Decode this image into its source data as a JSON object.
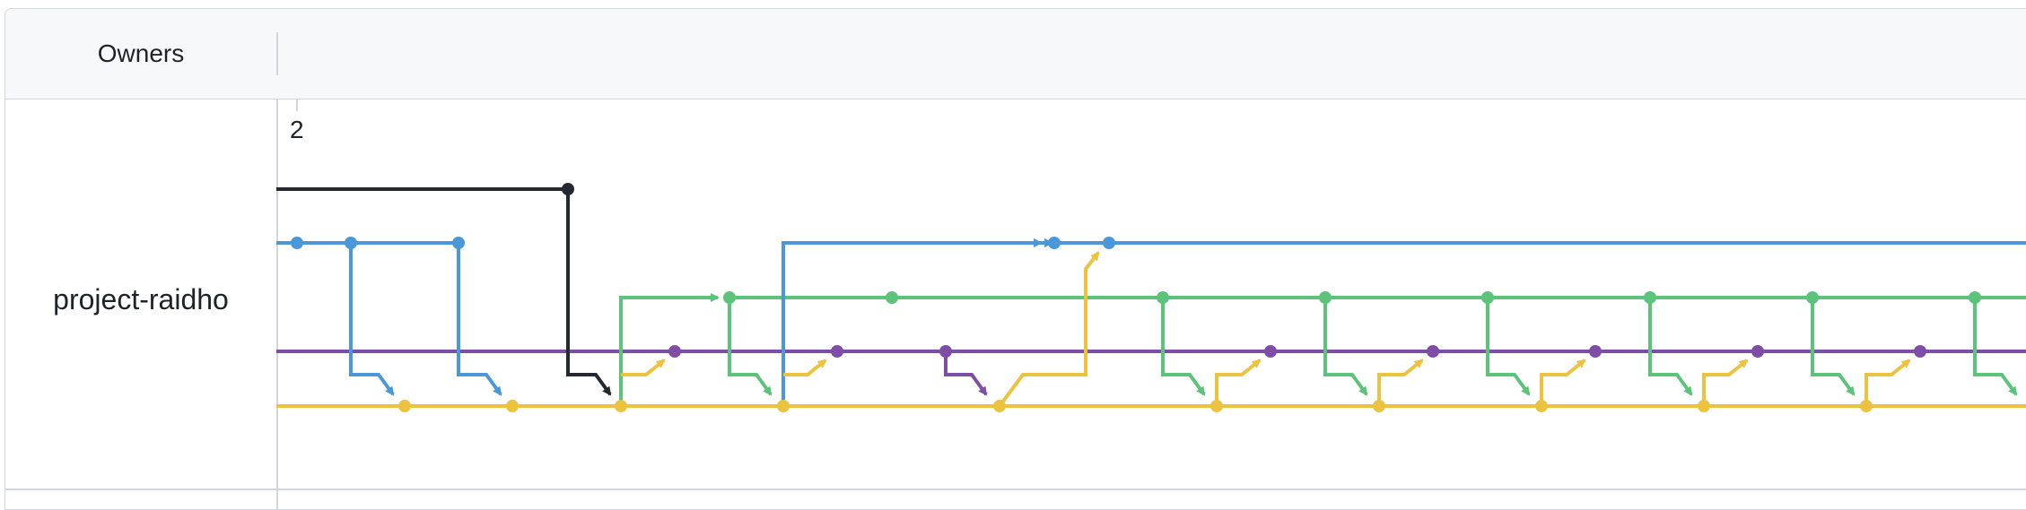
{
  "header": {
    "owners_label": "Owners"
  },
  "rows": [
    {
      "owner": "project-raidho",
      "tick_label": "2"
    }
  ],
  "colors": {
    "black": "#24292f",
    "blue": "#4a97d9",
    "green": "#5cc47a",
    "purple": "#7e4ea6",
    "yellow": "#ebc33f",
    "border": "#d0d7de",
    "header_bg": "#f6f8fa"
  }
}
